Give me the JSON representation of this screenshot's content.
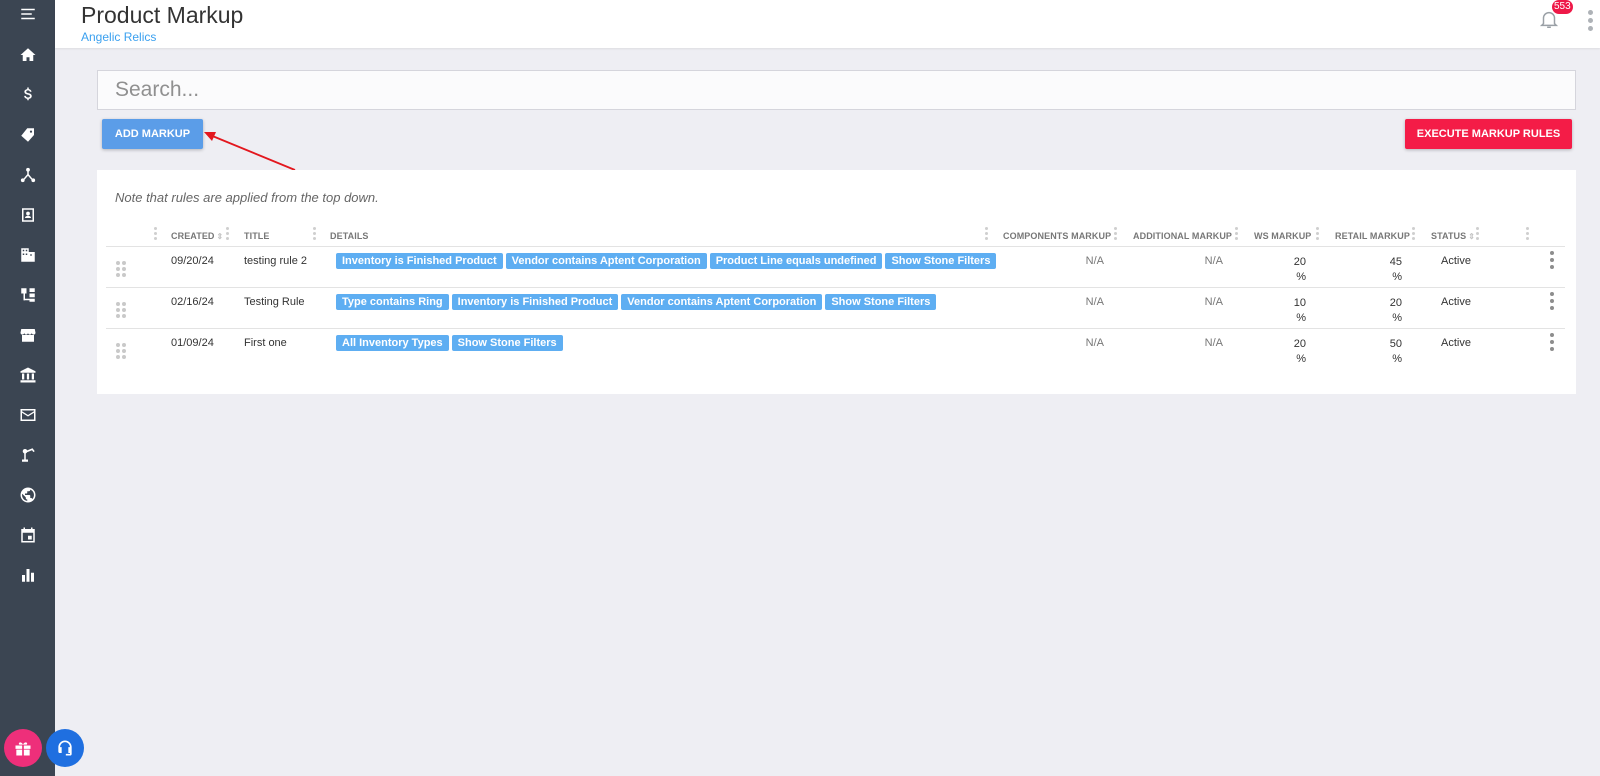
{
  "header": {
    "title": "Product Markup",
    "subtitle": "Angelic Relics",
    "notification_count": "553"
  },
  "sidebar": {
    "items": [
      {
        "icon": "menu-icon"
      },
      {
        "icon": "home-icon"
      },
      {
        "icon": "dollar-icon"
      },
      {
        "icon": "tags-icon"
      },
      {
        "icon": "network-icon"
      },
      {
        "icon": "contact-card-icon"
      },
      {
        "icon": "building-icon"
      },
      {
        "icon": "sitemap-icon"
      },
      {
        "icon": "store-icon"
      },
      {
        "icon": "bank-icon"
      },
      {
        "icon": "mail-icon"
      },
      {
        "icon": "robot-arm-icon"
      },
      {
        "icon": "globe-icon"
      },
      {
        "icon": "calendar-icon"
      },
      {
        "icon": "bar-chart-icon"
      }
    ]
  },
  "search": {
    "placeholder": "Search..."
  },
  "toolbar": {
    "add_label": "ADD MARKUP",
    "execute_label": "EXECUTE MARKUP RULES"
  },
  "colors": {
    "sidebar": "#3b4552",
    "add_button": "#5b9de8",
    "execute_button": "#f41c47",
    "chip": "#5eaef2",
    "subtitle": "#3aa0ef"
  },
  "table": {
    "note": "Note that rules are applied from the top down.",
    "columns": {
      "created": "CREATED",
      "title": "TITLE",
      "details": "DETAILS",
      "components": "COMPONENTS MARKUP",
      "additional": "ADDITIONAL MARKUP",
      "ws": "WS MARKUP",
      "retail": "RETAIL MARKUP",
      "status": "STATUS"
    },
    "rows": [
      {
        "created": "09/20/24",
        "title": "testing rule 2",
        "details": [
          "Inventory is Finished Product",
          "Vendor contains Aptent Corporation",
          "Product Line equals undefined",
          "Show Stone Filters"
        ],
        "components": "N/A",
        "additional": "N/A",
        "ws": "20",
        "retail": "45",
        "unit": "%",
        "status": "Active"
      },
      {
        "created": "02/16/24",
        "title": "Testing Rule",
        "details": [
          "Type contains Ring",
          "Inventory is Finished Product",
          "Vendor contains Aptent Corporation",
          "Show Stone Filters"
        ],
        "components": "N/A",
        "additional": "N/A",
        "ws": "10",
        "retail": "20",
        "unit": "%",
        "status": "Active"
      },
      {
        "created": "01/09/24",
        "title": "First one",
        "details": [
          "All Inventory Types",
          "Show Stone Filters"
        ],
        "components": "N/A",
        "additional": "N/A",
        "ws": "20",
        "retail": "50",
        "unit": "%",
        "status": "Active"
      }
    ]
  }
}
